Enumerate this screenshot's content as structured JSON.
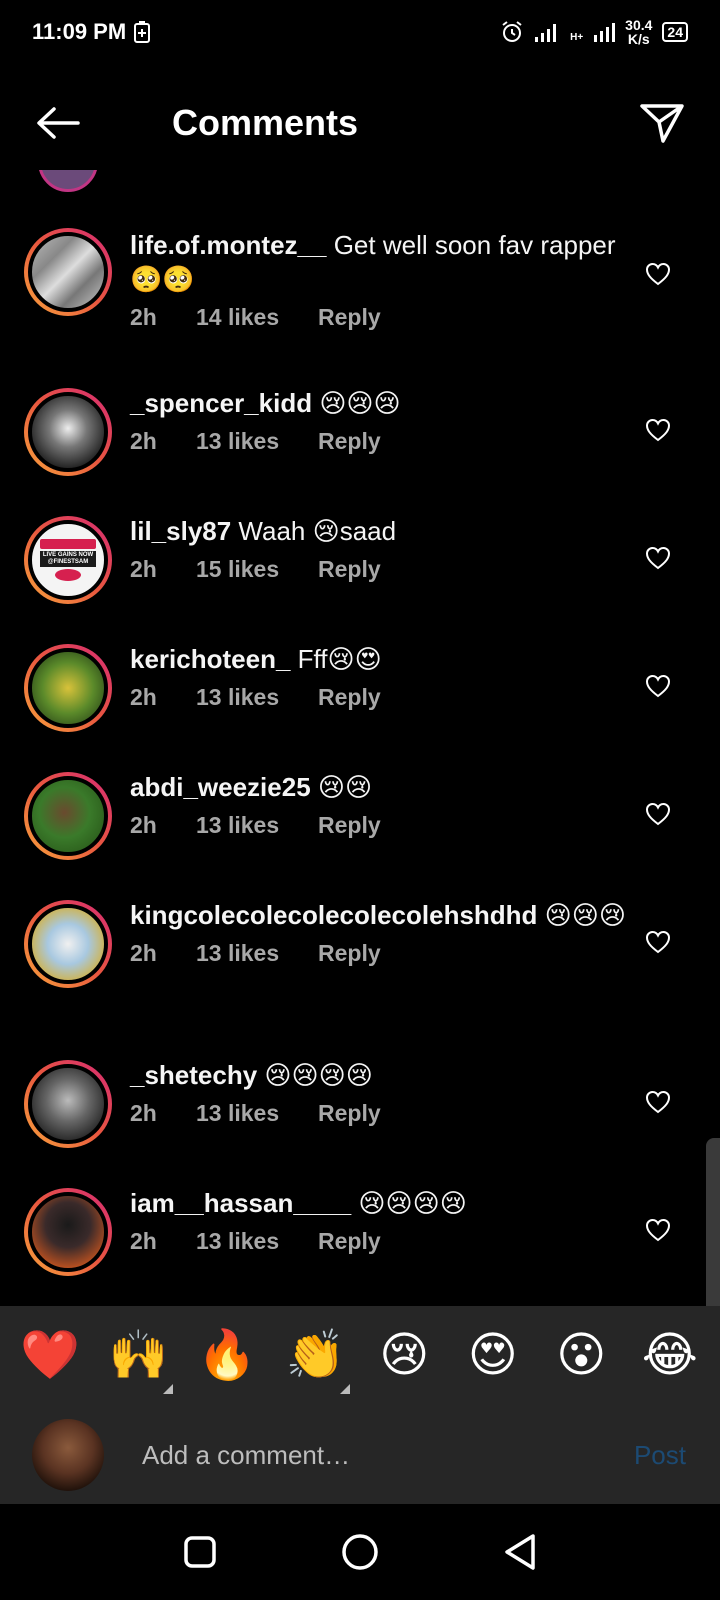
{
  "status_bar": {
    "time": "11:09 PM",
    "net_speed_value": "30.4",
    "net_speed_unit": "K/s",
    "network_type": "H+",
    "battery": "24"
  },
  "header": {
    "title": "Comments"
  },
  "comments": [
    {
      "username": "life.of.montez__",
      "text": " Get well soon fav rapper🥺🥺",
      "time": "2h",
      "likes": "14 likes",
      "reply": "Reply"
    },
    {
      "username": "_spencer_kidd",
      "text": " 😢😢😢",
      "time": "2h",
      "likes": "13 likes",
      "reply": "Reply"
    },
    {
      "username": "lil_sly87",
      "text": " Waah 😢saad",
      "time": "2h",
      "likes": "15 likes",
      "reply": "Reply",
      "avatar_lines": [
        "LIVE GAINS NOW",
        "@FINESTSAM"
      ]
    },
    {
      "username": "kerichoteen_",
      "text": " Fff😢😍",
      "time": "2h",
      "likes": "13 likes",
      "reply": "Reply"
    },
    {
      "username": "abdi_weezie25",
      "text": " 😢😢",
      "time": "2h",
      "likes": "13 likes",
      "reply": "Reply"
    },
    {
      "username": "kingcolecolecolecolecolehshdhd",
      "text": " 😢😢😢",
      "time": "2h",
      "likes": "13 likes",
      "reply": "Reply"
    },
    {
      "username": "_shetechy",
      "text": " 😢😢😢😢",
      "time": "2h",
      "likes": "13 likes",
      "reply": "Reply"
    },
    {
      "username": "iam__hassan____",
      "text": " 😢😢😢😢",
      "time": "2h",
      "likes": "13 likes",
      "reply": "Reply"
    }
  ],
  "emoji_bar": [
    "❤️",
    "🙌",
    "🔥",
    "👏",
    "😢",
    "😍",
    "😮",
    "😂"
  ],
  "compose": {
    "placeholder": "Add a comment…",
    "post_label": "Post"
  },
  "colors": {
    "background": "#000000",
    "secondary_text": "#a8a8a8",
    "post_button": "#1c4a73",
    "story_ring_start": "#f9a43c",
    "story_ring_end": "#d62976"
  }
}
